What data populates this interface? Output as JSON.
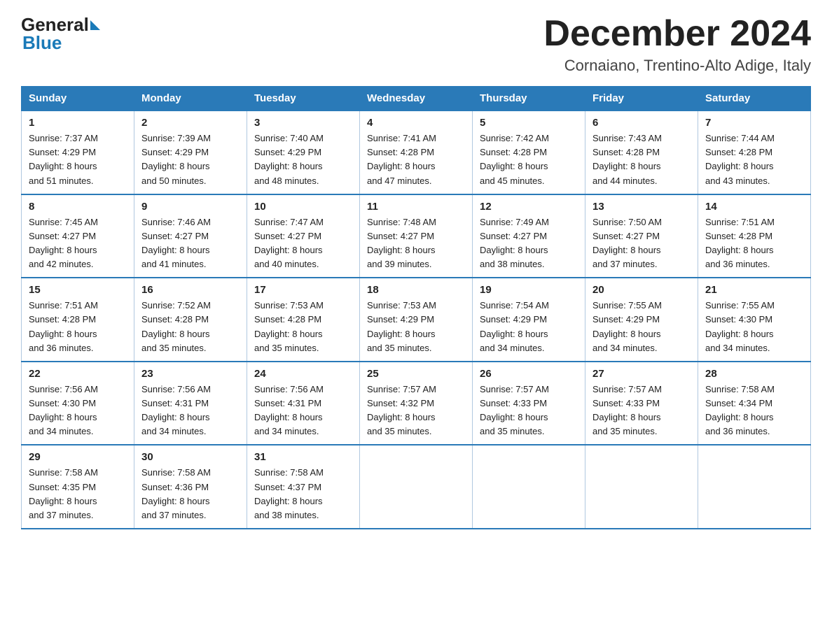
{
  "header": {
    "logo_general": "General",
    "logo_blue": "Blue",
    "month_title": "December 2024",
    "subtitle": "Cornaiano, Trentino-Alto Adige, Italy"
  },
  "calendar": {
    "headers": [
      "Sunday",
      "Monday",
      "Tuesday",
      "Wednesday",
      "Thursday",
      "Friday",
      "Saturday"
    ],
    "weeks": [
      [
        {
          "day": "1",
          "sunrise": "7:37 AM",
          "sunset": "4:29 PM",
          "daylight": "8 hours and 51 minutes."
        },
        {
          "day": "2",
          "sunrise": "7:39 AM",
          "sunset": "4:29 PM",
          "daylight": "8 hours and 50 minutes."
        },
        {
          "day": "3",
          "sunrise": "7:40 AM",
          "sunset": "4:29 PM",
          "daylight": "8 hours and 48 minutes."
        },
        {
          "day": "4",
          "sunrise": "7:41 AM",
          "sunset": "4:28 PM",
          "daylight": "8 hours and 47 minutes."
        },
        {
          "day": "5",
          "sunrise": "7:42 AM",
          "sunset": "4:28 PM",
          "daylight": "8 hours and 45 minutes."
        },
        {
          "day": "6",
          "sunrise": "7:43 AM",
          "sunset": "4:28 PM",
          "daylight": "8 hours and 44 minutes."
        },
        {
          "day": "7",
          "sunrise": "7:44 AM",
          "sunset": "4:28 PM",
          "daylight": "8 hours and 43 minutes."
        }
      ],
      [
        {
          "day": "8",
          "sunrise": "7:45 AM",
          "sunset": "4:27 PM",
          "daylight": "8 hours and 42 minutes."
        },
        {
          "day": "9",
          "sunrise": "7:46 AM",
          "sunset": "4:27 PM",
          "daylight": "8 hours and 41 minutes."
        },
        {
          "day": "10",
          "sunrise": "7:47 AM",
          "sunset": "4:27 PM",
          "daylight": "8 hours and 40 minutes."
        },
        {
          "day": "11",
          "sunrise": "7:48 AM",
          "sunset": "4:27 PM",
          "daylight": "8 hours and 39 minutes."
        },
        {
          "day": "12",
          "sunrise": "7:49 AM",
          "sunset": "4:27 PM",
          "daylight": "8 hours and 38 minutes."
        },
        {
          "day": "13",
          "sunrise": "7:50 AM",
          "sunset": "4:27 PM",
          "daylight": "8 hours and 37 minutes."
        },
        {
          "day": "14",
          "sunrise": "7:51 AM",
          "sunset": "4:28 PM",
          "daylight": "8 hours and 36 minutes."
        }
      ],
      [
        {
          "day": "15",
          "sunrise": "7:51 AM",
          "sunset": "4:28 PM",
          "daylight": "8 hours and 36 minutes."
        },
        {
          "day": "16",
          "sunrise": "7:52 AM",
          "sunset": "4:28 PM",
          "daylight": "8 hours and 35 minutes."
        },
        {
          "day": "17",
          "sunrise": "7:53 AM",
          "sunset": "4:28 PM",
          "daylight": "8 hours and 35 minutes."
        },
        {
          "day": "18",
          "sunrise": "7:53 AM",
          "sunset": "4:29 PM",
          "daylight": "8 hours and 35 minutes."
        },
        {
          "day": "19",
          "sunrise": "7:54 AM",
          "sunset": "4:29 PM",
          "daylight": "8 hours and 34 minutes."
        },
        {
          "day": "20",
          "sunrise": "7:55 AM",
          "sunset": "4:29 PM",
          "daylight": "8 hours and 34 minutes."
        },
        {
          "day": "21",
          "sunrise": "7:55 AM",
          "sunset": "4:30 PM",
          "daylight": "8 hours and 34 minutes."
        }
      ],
      [
        {
          "day": "22",
          "sunrise": "7:56 AM",
          "sunset": "4:30 PM",
          "daylight": "8 hours and 34 minutes."
        },
        {
          "day": "23",
          "sunrise": "7:56 AM",
          "sunset": "4:31 PM",
          "daylight": "8 hours and 34 minutes."
        },
        {
          "day": "24",
          "sunrise": "7:56 AM",
          "sunset": "4:31 PM",
          "daylight": "8 hours and 34 minutes."
        },
        {
          "day": "25",
          "sunrise": "7:57 AM",
          "sunset": "4:32 PM",
          "daylight": "8 hours and 35 minutes."
        },
        {
          "day": "26",
          "sunrise": "7:57 AM",
          "sunset": "4:33 PM",
          "daylight": "8 hours and 35 minutes."
        },
        {
          "day": "27",
          "sunrise": "7:57 AM",
          "sunset": "4:33 PM",
          "daylight": "8 hours and 35 minutes."
        },
        {
          "day": "28",
          "sunrise": "7:58 AM",
          "sunset": "4:34 PM",
          "daylight": "8 hours and 36 minutes."
        }
      ],
      [
        {
          "day": "29",
          "sunrise": "7:58 AM",
          "sunset": "4:35 PM",
          "daylight": "8 hours and 37 minutes."
        },
        {
          "day": "30",
          "sunrise": "7:58 AM",
          "sunset": "4:36 PM",
          "daylight": "8 hours and 37 minutes."
        },
        {
          "day": "31",
          "sunrise": "7:58 AM",
          "sunset": "4:37 PM",
          "daylight": "8 hours and 38 minutes."
        },
        null,
        null,
        null,
        null
      ]
    ],
    "sunrise_label": "Sunrise:",
    "sunset_label": "Sunset:",
    "daylight_label": "Daylight:"
  }
}
